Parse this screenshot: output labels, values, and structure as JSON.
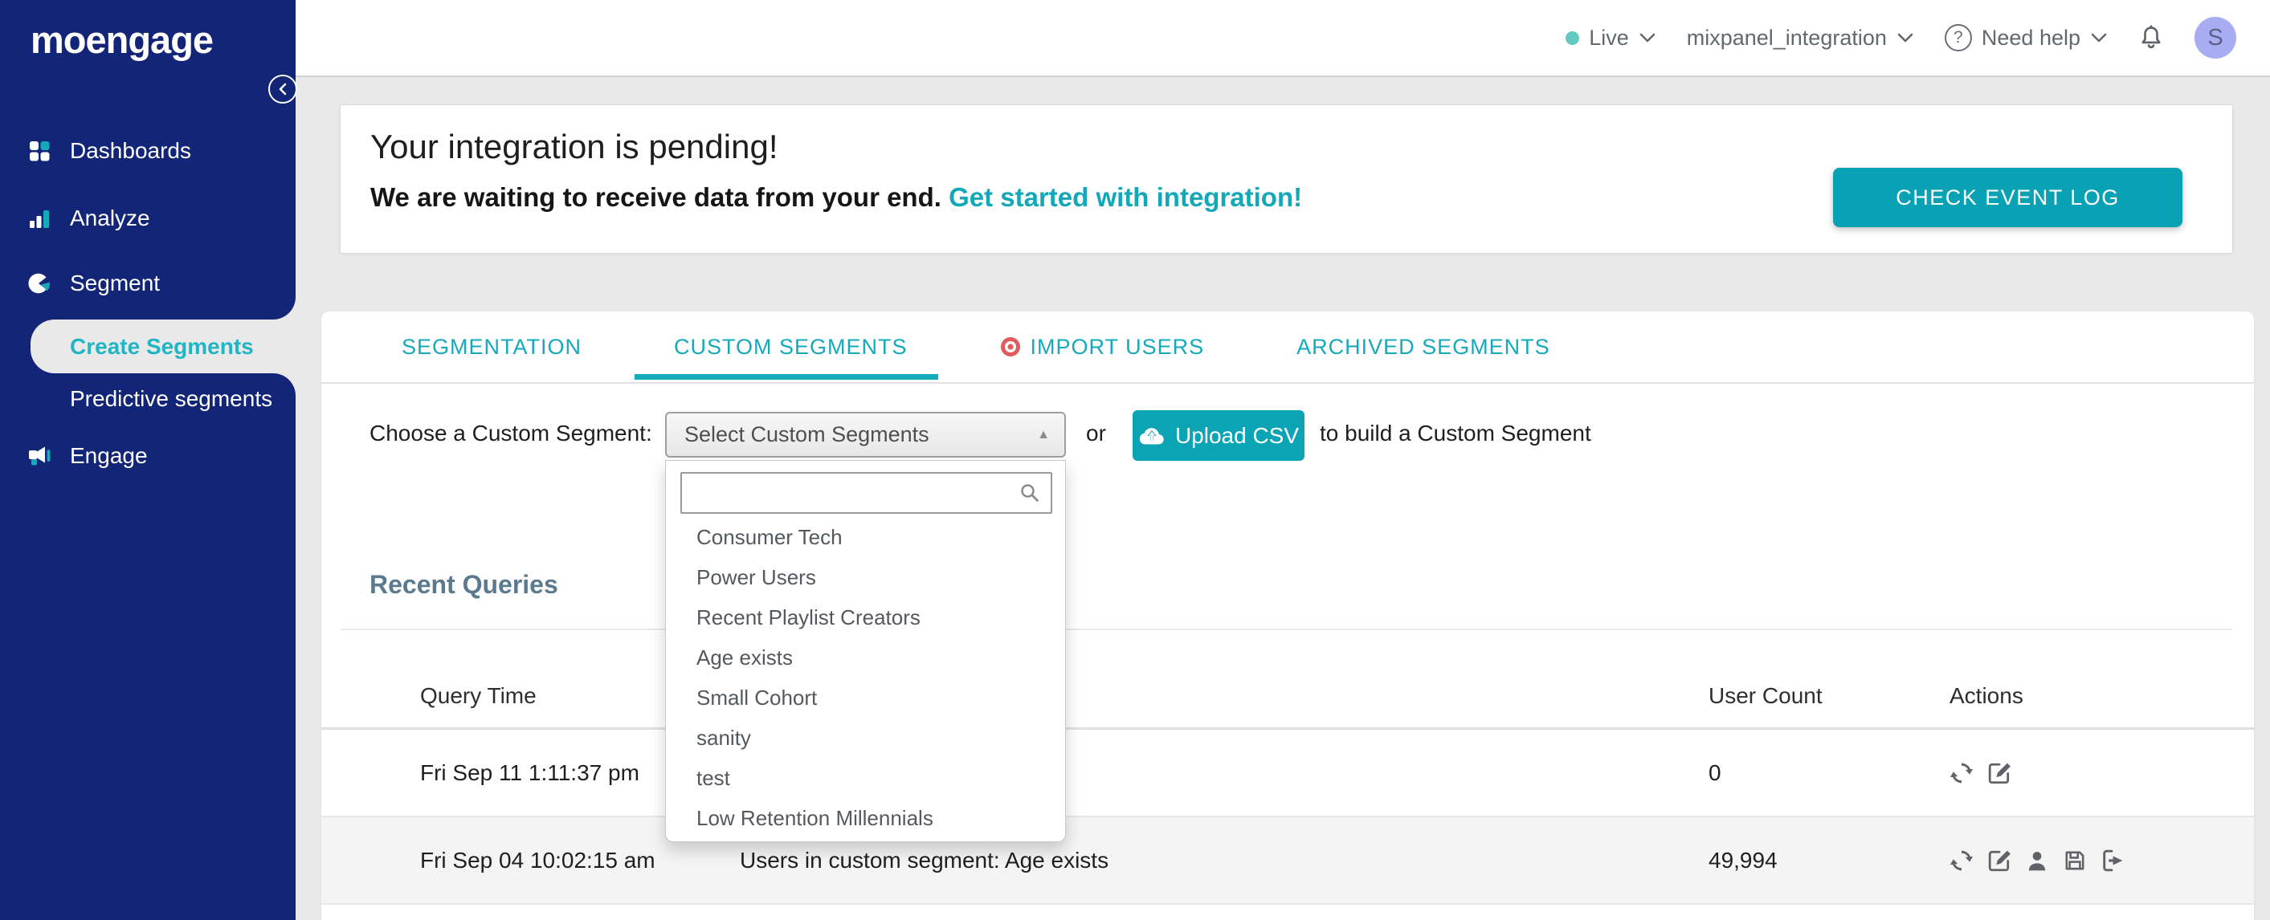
{
  "colors": {
    "navy": "#122577",
    "teal_button": "#0aa3b5",
    "tab_teal": "#16a9ba",
    "link_teal": "#12a8ba",
    "active_item_teal": "#1fb5c5",
    "import_badge_red": "#e25c5c",
    "avatar_bg": "#a8acf3",
    "live_dot": "#63c9c3",
    "page_bg": "#e9e9e9",
    "heading_slate": "#5b7a8e"
  },
  "topbar": {
    "env_label": "Live",
    "project_name": "mixpanel_integration",
    "help_label": "Need help",
    "avatar_initial": "S"
  },
  "sidebar": {
    "logo": "moengage",
    "items": [
      {
        "label": "Dashboards"
      },
      {
        "label": "Analyze"
      },
      {
        "label": "Segment"
      },
      {
        "label": "Create Segments"
      },
      {
        "label": "Predictive segments"
      },
      {
        "label": "Engage"
      }
    ]
  },
  "banner": {
    "title": "Your integration is pending!",
    "subtitle": "We are waiting to receive data from your end. ",
    "link_label": "Get started with integration!",
    "button_label": "CHECK EVENT LOG"
  },
  "tabs": [
    {
      "label": "SEGMENTATION"
    },
    {
      "label": "CUSTOM SEGMENTS"
    },
    {
      "label": "IMPORT USERS"
    },
    {
      "label": "ARCHIVED SEGMENTS"
    }
  ],
  "chooser": {
    "label": "Choose a Custom Segment:",
    "select_value": "Select Custom Segments",
    "or_text": "or",
    "upload_label": "Upload CSV",
    "suffix_text": "to build a Custom Segment",
    "search_value": ""
  },
  "dropdown": {
    "items": [
      "Consumer Tech",
      "Power Users",
      "Recent Playlist Creators",
      "Age exists",
      "Small Cohort",
      "sanity",
      "test",
      "Low Retention Millennials"
    ]
  },
  "recent_queries": {
    "title": "Recent Queries",
    "columns": {
      "time": "Query Time",
      "count": "User Count",
      "actions": "Actions"
    },
    "rows": [
      {
        "time": "Fri Sep 11 1:11:37 pm",
        "query": "",
        "count": "0"
      },
      {
        "time": "Fri Sep 04 10:02:15 am",
        "query": "Users in custom segment: Age exists",
        "count": "49,994"
      }
    ]
  }
}
